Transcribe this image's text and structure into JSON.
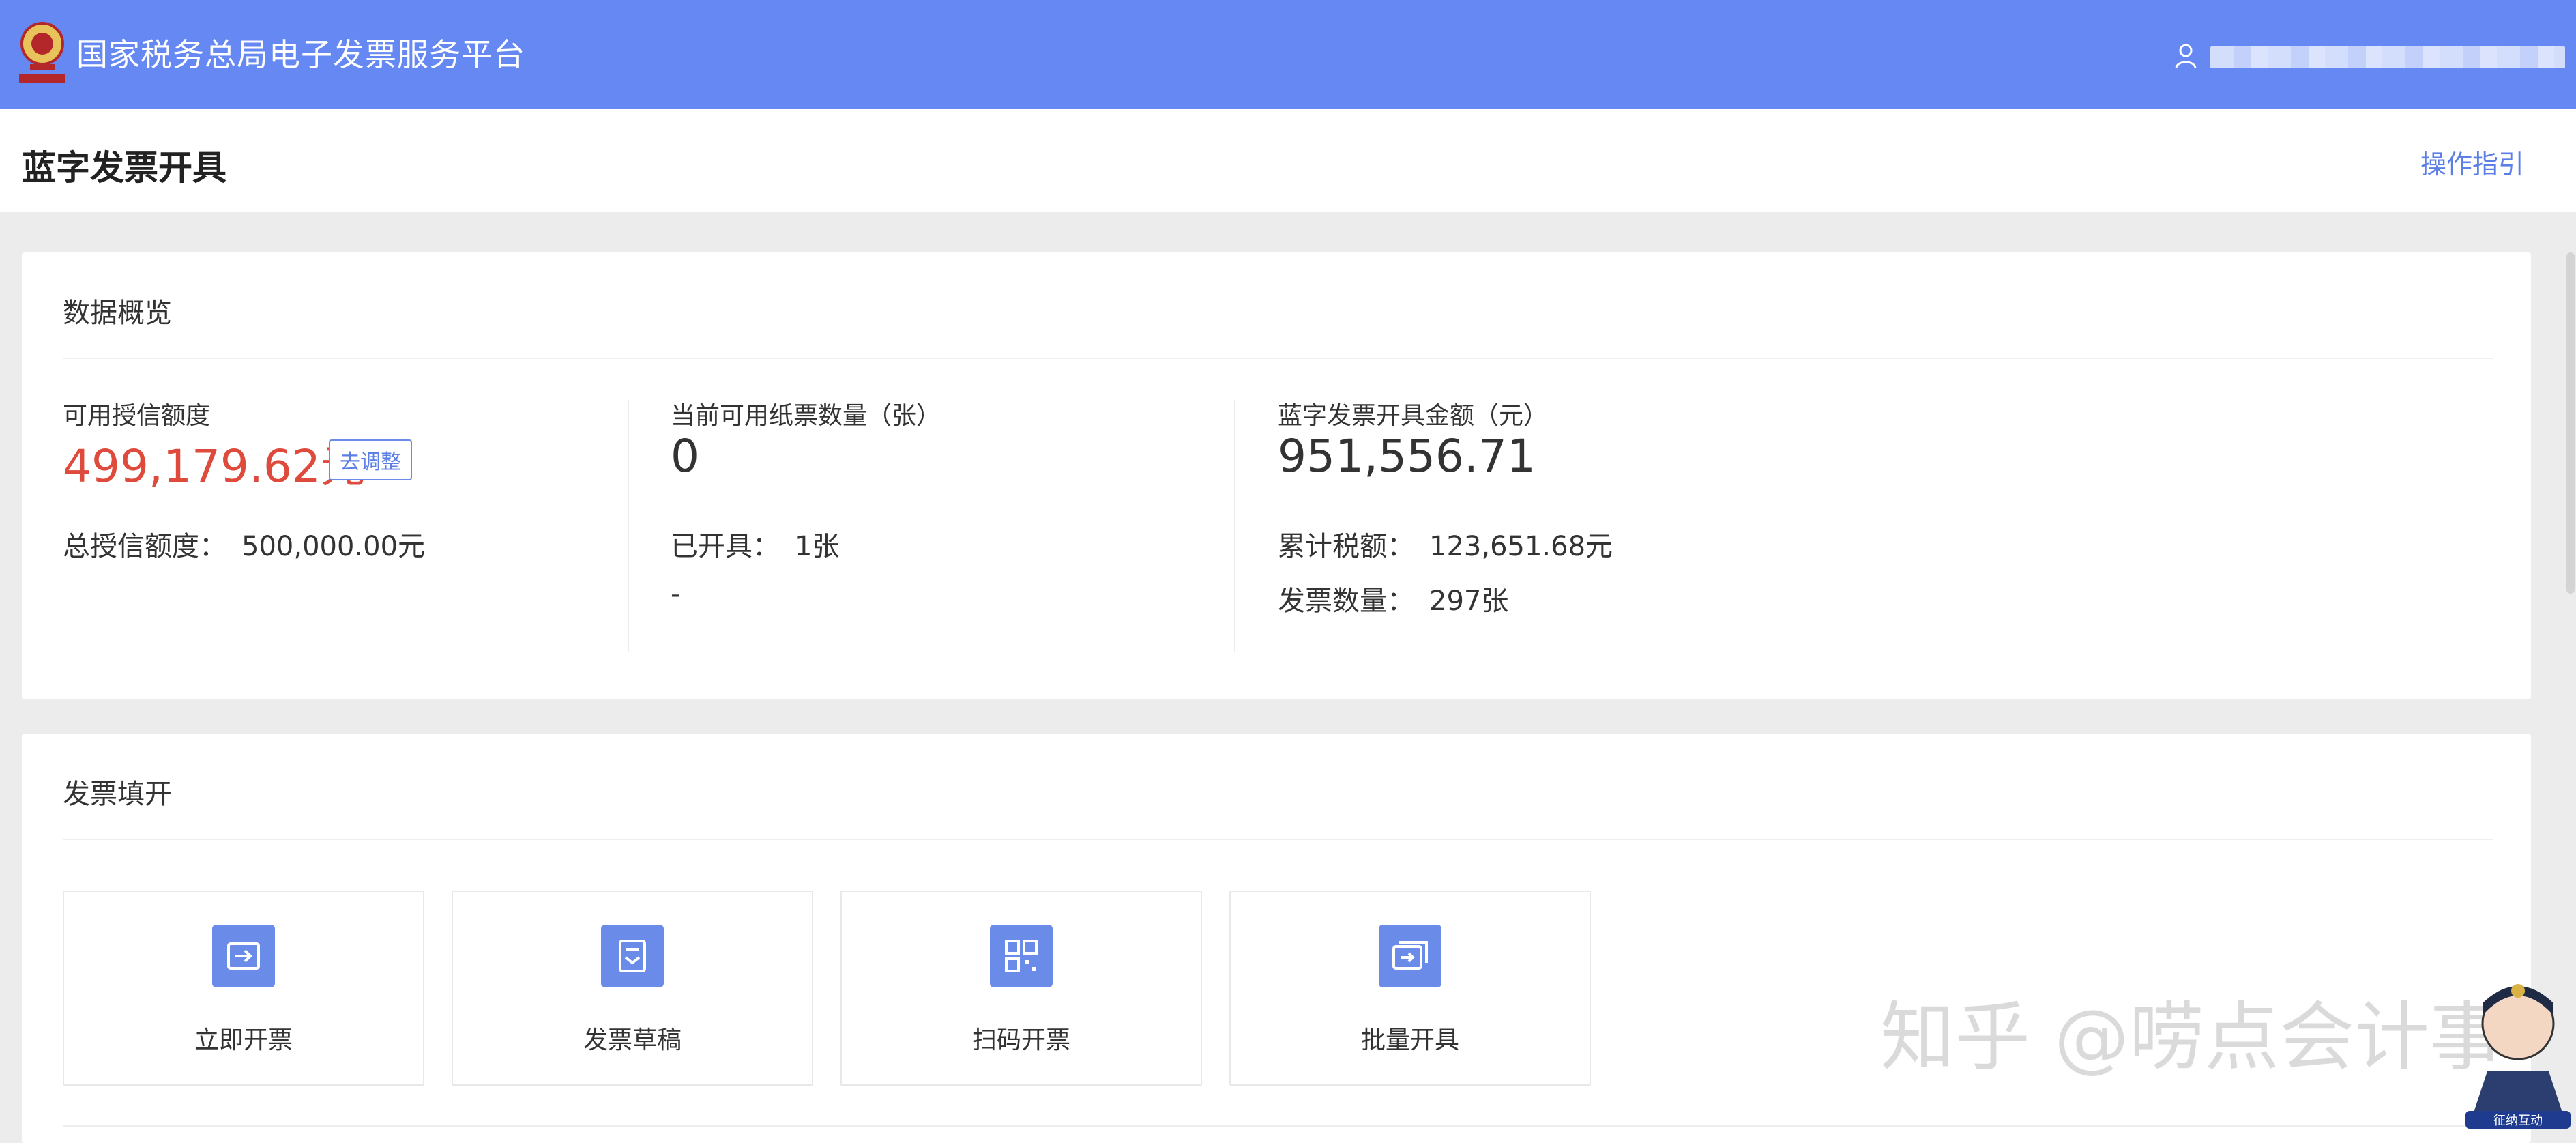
{
  "header": {
    "title": "国家税务总局电子发票服务平台",
    "emblem_icon": "tax-emblem-icon",
    "user_icon": "user-icon",
    "brand_color": "#6588f2"
  },
  "page": {
    "title": "蓝字发票开具",
    "guide_link": "操作指引"
  },
  "overview": {
    "title": "数据概览",
    "credit": {
      "label": "可用授信额度",
      "value": "499,179.62元",
      "adjust_button": "去调整",
      "total_label": "总授信额度：",
      "total_value": "500,000.00元"
    },
    "paper": {
      "label": "当前可用纸票数量（张）",
      "value": "0",
      "issued_label": "已开具：",
      "issued_value": "1张",
      "extra": "-"
    },
    "amount": {
      "label": "蓝字发票开具金额（元）",
      "value": "951,556.71",
      "tax_label": "累计税额：",
      "tax_value": "123,651.68元",
      "count_label": "发票数量：",
      "count_value": "297张"
    },
    "accent_red": "#de4b3c"
  },
  "issue": {
    "title": "发票填开",
    "actions": [
      {
        "label": "立即开票",
        "icon": "issue-now-icon"
      },
      {
        "label": "发票草稿",
        "icon": "draft-icon"
      },
      {
        "label": "扫码开票",
        "icon": "qr-code-icon"
      },
      {
        "label": "批量开具",
        "icon": "batch-issue-icon"
      }
    ]
  },
  "watermark": {
    "text": "知乎 @唠点会计事",
    "badge": "征纳互动"
  }
}
